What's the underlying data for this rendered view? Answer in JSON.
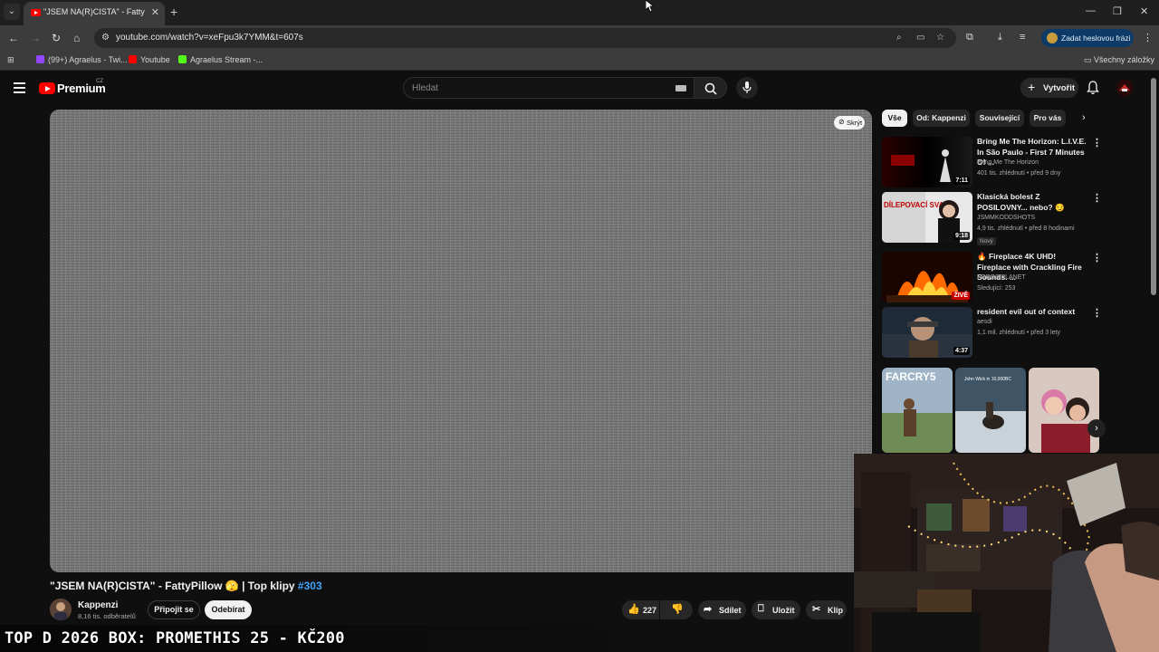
{
  "browser": {
    "tab_title": "\"JSEM NA(R)CISTA\" - FattyPillow",
    "url": "youtube.com/watch?v=xeFpu3k7YMM&t=607s",
    "password_pill": "Zadat heslovou frázi",
    "bookmarks": [
      {
        "label": "(99+) Agraelus - Twi...",
        "color": "#9146ff"
      },
      {
        "label": "Youtube",
        "color": "#ff0000"
      },
      {
        "label": "Agraelus Stream -...",
        "color": "#53fc18"
      }
    ],
    "all_bookmarks": "Všechny záložky"
  },
  "youtube": {
    "logo_text": "Premium",
    "logo_country": "CZ",
    "search_placeholder": "Hledat",
    "create_label": "Vytvořit"
  },
  "player": {
    "hide_label": "Skrýt"
  },
  "video": {
    "title": "\"JSEM NA(R)CISTA\" - FattyPillow 🫣 | Top klipy ",
    "hashtag": "#303",
    "channel": "Kappenzi",
    "subscribers": "8,16 tis. odběratelů",
    "join_label": "Připojit se",
    "subscribe_label": "Odebírat",
    "likes": "227",
    "share_label": "Sdílet",
    "save_label": "Uložit",
    "clip_label": "Klip"
  },
  "sidebar": {
    "chips": [
      "Vše",
      "Od: Kappenzi",
      "Související",
      "Pro vás"
    ],
    "recommendations": [
      {
        "title": "Bring Me The Horizon: L.I.V.E. In São Paulo - First 7 Minutes Of ...",
        "channel": "Bring Me The Horizon",
        "meta": "401 tis. zhlédnutí • před 9 dny",
        "duration": "7:11"
      },
      {
        "title": "Klasická bolest Z POSILOVNY... nebo? 😏",
        "channel": "JSMMKODDSHOTS",
        "meta": "4,9 tis. zhlédnutí • před 8 hodinami",
        "duration": "9:18",
        "badge": "Nový",
        "thumb_text": "DÍLEPOVACÍ SVALY"
      },
      {
        "title": "🔥 Fireplace 4K UHD! Fireplace with Crackling Fire Sounds. ...",
        "channel": "FOBOS PLANET",
        "meta": "Sledující: 253",
        "duration": "ŽIVĚ"
      },
      {
        "title": "resident evil out of context",
        "channel": "aesdi",
        "meta": "1,1 mil. zhlédnutí • před 3 lety",
        "duration": "4:37"
      }
    ],
    "shorts": [
      {
        "label": "FARCRY5"
      },
      {
        "label": "John Wick in 10,000BC"
      },
      {
        "label": ""
      }
    ]
  },
  "stream_overlay": {
    "ticker": "TOP D 2026 BOX: PROMETHIS 25 - KČ200"
  },
  "colors": {
    "yt_red": "#ff0000",
    "link_blue": "#3ea6ff",
    "page_bg": "#0f0f0f"
  }
}
